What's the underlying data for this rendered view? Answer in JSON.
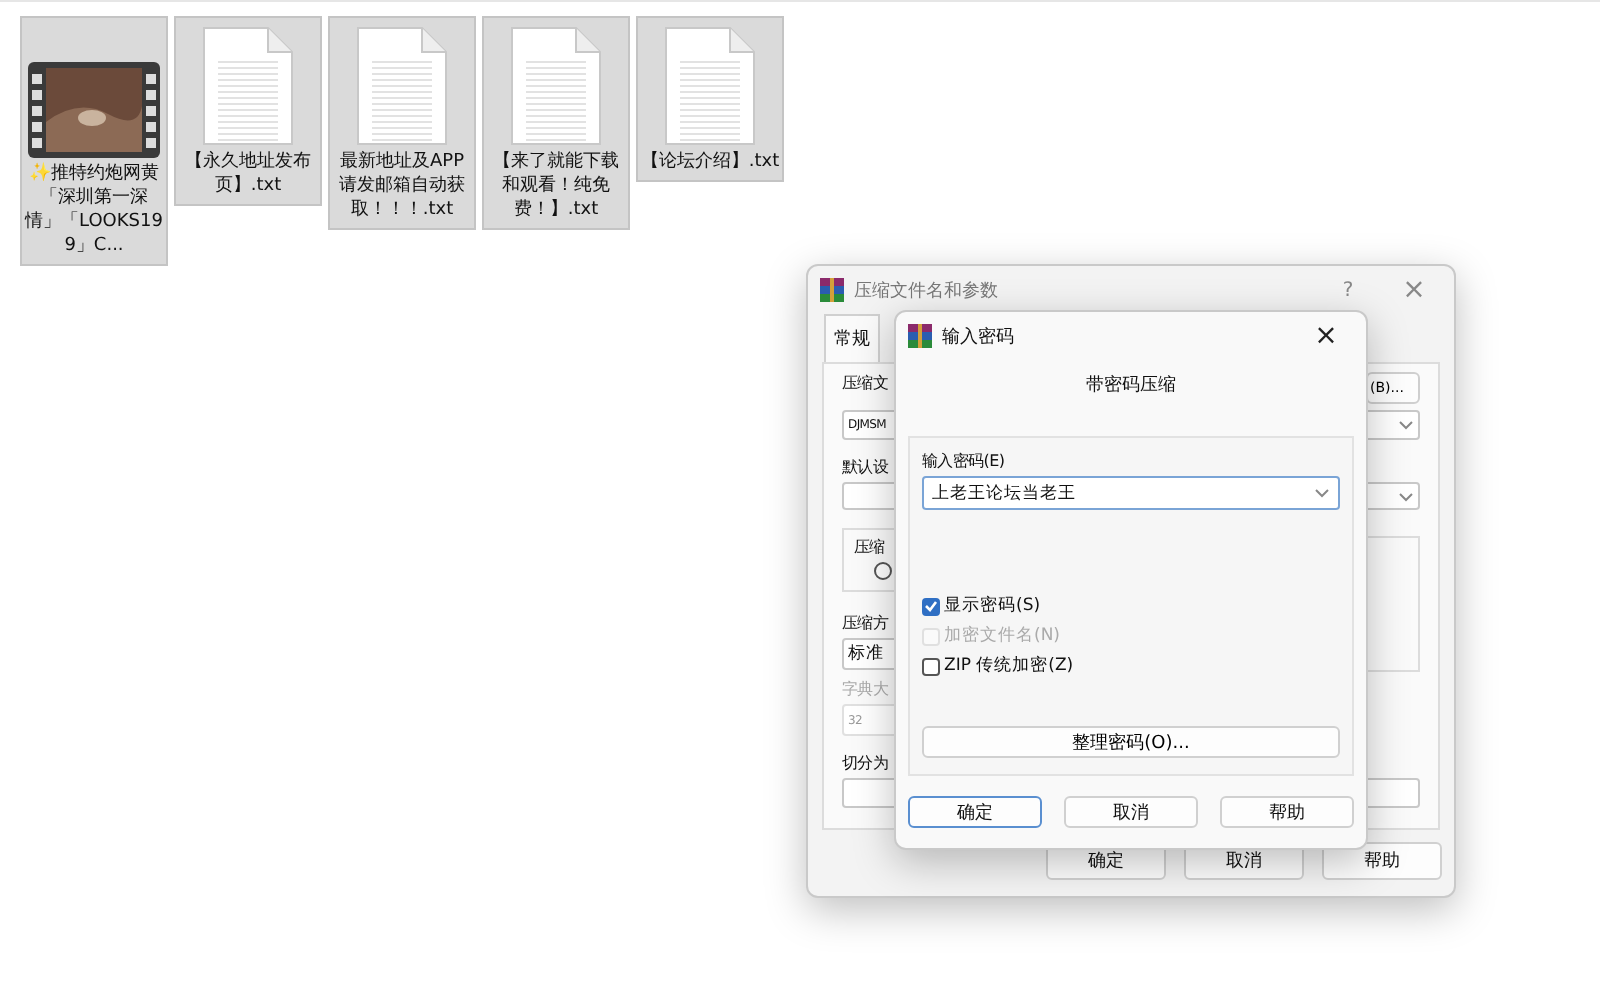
{
  "desktop": {
    "files": [
      {
        "name": "✨推特约炮网黄「深圳第一深情」「LOOKS199」C...",
        "kind": "video",
        "selected": true
      },
      {
        "name": "【永久地址发布页】.txt",
        "kind": "text",
        "selected": true
      },
      {
        "name": "最新地址及APP请发邮箱自动获取！！！.txt",
        "kind": "text",
        "selected": true
      },
      {
        "name": "【来了就能下载和观看！纯免费！】.txt",
        "kind": "text",
        "selected": true
      },
      {
        "name": "【论坛介绍】.txt",
        "kind": "text",
        "selected": true
      }
    ]
  },
  "archive_dialog": {
    "title": "压缩文件名和参数",
    "help": "?",
    "close": "×",
    "tabs": [
      {
        "label": "常规",
        "selected": true
      }
    ],
    "archive_name_label": "压缩文",
    "browse_button": "(B)...",
    "archive_name": "DJMSM",
    "profile_label": "默认设",
    "group_label": "压缩",
    "radio": {
      "selected": false
    },
    "method_label": "压缩方",
    "method": "标准",
    "dictionary_label": "字典大",
    "dictionary_disabled": true,
    "dictionary": "32",
    "split_label": "切分为",
    "buttons": [
      "确定",
      "取消",
      "帮助"
    ]
  },
  "password_dialog": {
    "title": "输入密码",
    "close": "×",
    "heading": "带密码压缩",
    "password_label": "输入密码(E)",
    "password": "上老王论坛当老王",
    "options": [
      {
        "label": "显示密码(S)",
        "checked": true,
        "disabled": false
      },
      {
        "label": "加密文件名(N)",
        "checked": false,
        "disabled": true
      },
      {
        "label": "ZIP 传统加密(Z)",
        "checked": false,
        "disabled": false
      }
    ],
    "organize_button": "整理密码(O)...",
    "buttons": [
      {
        "label": "确定",
        "selected": true
      },
      {
        "label": "取消",
        "selected": false
      },
      {
        "label": "帮助",
        "selected": false
      }
    ]
  }
}
